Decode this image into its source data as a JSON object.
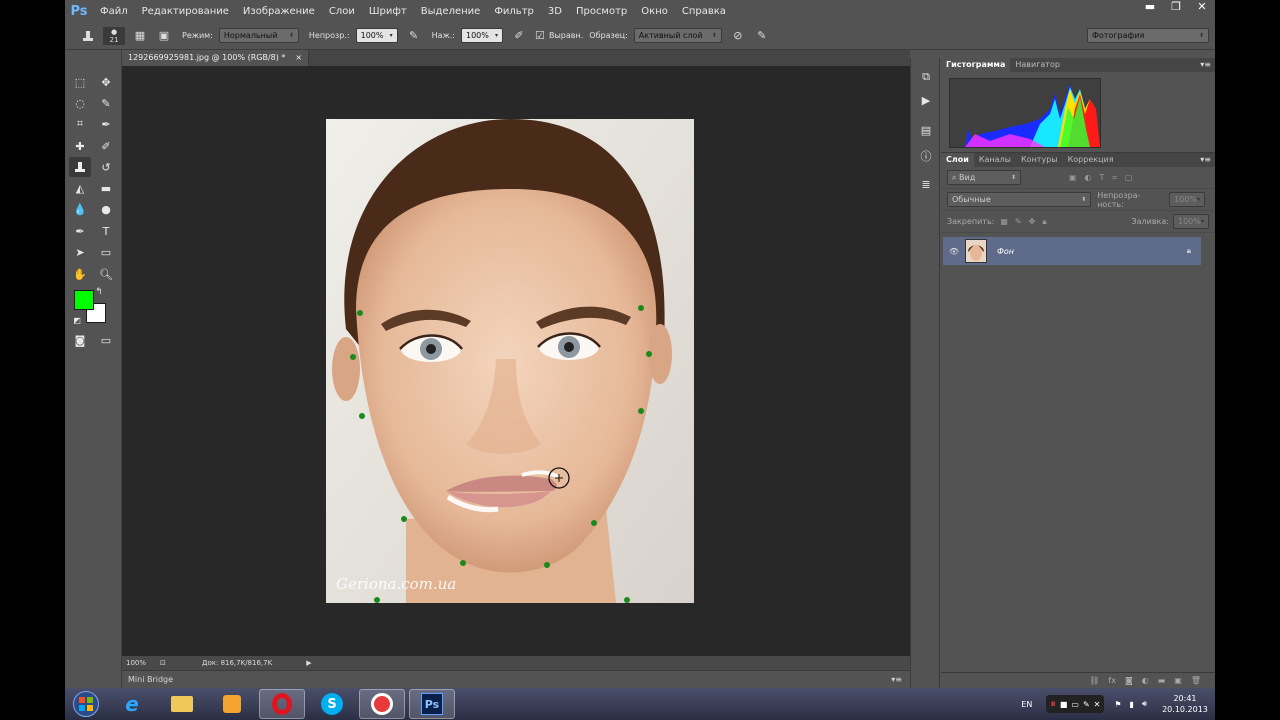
{
  "app": {
    "logo": "Ps",
    "doc_title": "1292669925981.jpg @ 100% (RGB/8) *",
    "doc_close": "×"
  },
  "window_controls": {
    "minimize": "▬",
    "restore": "❐",
    "close": "✕"
  },
  "menu": [
    "Файл",
    "Редактирование",
    "Изображение",
    "Слои",
    "Шрифт",
    "Выделение",
    "Фильтр",
    "3D",
    "Просмотр",
    "Окно",
    "Справка"
  ],
  "options": {
    "brush_size": "21",
    "mode_label": "Режим:",
    "mode_value": "Нормальный",
    "opacity_label": "Непрозр.:",
    "opacity_value": "100%",
    "pressure_label": "Наж.:",
    "pressure_value": "100%",
    "aligned_label": "Выравн.",
    "sample_label": "Образец:",
    "sample_value": "Активный слой",
    "workspace": "Фотография"
  },
  "status": {
    "zoom": "100%",
    "doc_info": "Док: 816,7K/816,7K"
  },
  "mini_bridge": "Mini Bridge",
  "watermark": "Geriona.com.ua",
  "panels": {
    "histogram_tabs": [
      "Гистограмма",
      "Навигатор"
    ],
    "layers_tabs": [
      "Слои",
      "Каналы",
      "Контуры",
      "Коррекция"
    ],
    "filter_kind": "Вид",
    "blend_mode": "Обычные",
    "opacity_label": "Непрозра-ность:",
    "opacity_value": "100%",
    "lock_label": "Закрепить:",
    "fill_label": "Заливка:",
    "fill_value": "100%",
    "layer_name": "Фон"
  },
  "tray": {
    "lang": "EN",
    "time": "20:41",
    "date": "20.10.2013"
  },
  "colors": {
    "foreground": "#00ff00",
    "background": "#ffffff",
    "selected_layer": "#5f6b8b"
  }
}
